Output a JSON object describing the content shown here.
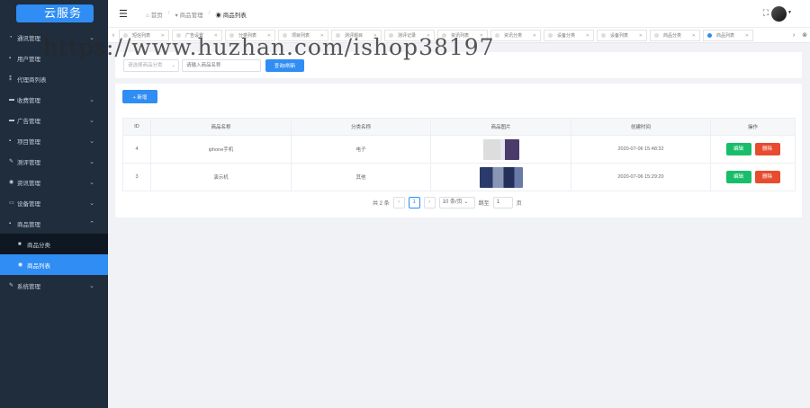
{
  "logo": {
    "text": "云服务"
  },
  "sidebar": {
    "items": [
      {
        "label": "通讯管理",
        "icon": "chat-icon",
        "glyph": "◔",
        "arrow": "⌄"
      },
      {
        "label": "用户管理",
        "icon": "user-icon",
        "glyph": "▪",
        "arrow": ""
      },
      {
        "label": "代理商列表",
        "icon": "person-icon",
        "glyph": "⁑",
        "arrow": ""
      },
      {
        "label": "收费管理",
        "icon": "payment-icon",
        "glyph": "▬",
        "arrow": "⌄"
      },
      {
        "label": "广告管理",
        "icon": "ad-icon",
        "glyph": "▬",
        "arrow": "⌄"
      },
      {
        "label": "项目管理",
        "icon": "project-icon",
        "glyph": "▪",
        "arrow": "⌄"
      },
      {
        "label": "测评管理",
        "icon": "edit-icon",
        "glyph": "✎",
        "arrow": "⌄"
      },
      {
        "label": "资讯管理",
        "icon": "info-icon",
        "glyph": "◉",
        "arrow": "⌄"
      },
      {
        "label": "设备管理",
        "icon": "device-icon",
        "glyph": "▭",
        "arrow": "⌄"
      },
      {
        "label": "商品管理",
        "icon": "goods-icon",
        "glyph": "▪",
        "arrow": "⌃"
      }
    ],
    "sub": [
      {
        "label": "商品分类",
        "glyph": "■",
        "active": false
      },
      {
        "label": "商品列表",
        "glyph": "◉",
        "active": true
      }
    ],
    "last": {
      "label": "系统管理",
      "icon": "wrench-icon",
      "glyph": "✎",
      "arrow": "⌄"
    }
  },
  "header": {
    "breadcrumb": [
      "首页",
      "商品管理",
      "商品列表"
    ],
    "sep": "/"
  },
  "tabs": [
    {
      "label": "短信列表",
      "active": false
    },
    {
      "label": "广告设置",
      "active": false
    },
    {
      "label": "分类列表",
      "active": false
    },
    {
      "label": "项目列表",
      "active": false
    },
    {
      "label": "测评题目",
      "active": false
    },
    {
      "label": "测评记录",
      "active": false
    },
    {
      "label": "资讯列表",
      "active": false
    },
    {
      "label": "资讯分类",
      "active": false
    },
    {
      "label": "设备分类",
      "active": false
    },
    {
      "label": "设备列表",
      "active": false
    },
    {
      "label": "商品分类",
      "active": false
    },
    {
      "label": "商品列表",
      "active": true
    }
  ],
  "search": {
    "category_placeholder": "请选择商品分类",
    "name_placeholder": "请输入商品名称",
    "query_label": "查询/刷新"
  },
  "toolbar": {
    "add_label": "+ 新增"
  },
  "table": {
    "headers": [
      "ID",
      "商品名称",
      "分类名称",
      "商品图片",
      "创建时间",
      "操作"
    ],
    "rows": [
      {
        "id": "4",
        "name": "iphone手机",
        "category": "电子",
        "created": "2020-07-06 15:48:32",
        "edit": "编辑",
        "del": "删除"
      },
      {
        "id": "3",
        "name": "演示机",
        "category": "其他",
        "created": "2020-07-06 15:29:20",
        "edit": "编辑",
        "del": "删除"
      }
    ]
  },
  "pager": {
    "total_text": "共 2 条",
    "prev": "‹",
    "page": "1",
    "next": "›",
    "page_size": "10 条/页",
    "jump_label": "跳至",
    "jump_value": "1",
    "page_unit": "页"
  },
  "watermark": "https://www.huzhan.com/ishop38197",
  "colors": {
    "sidebar": "#1f2d3d",
    "primary": "#2f8df4",
    "success": "#19be6b",
    "danger": "#e74c2e"
  }
}
